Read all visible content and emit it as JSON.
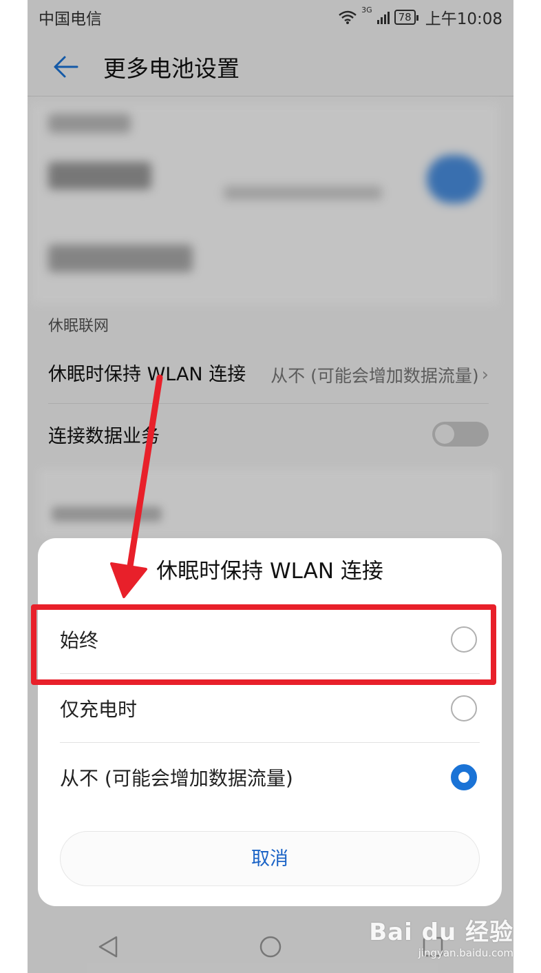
{
  "status_bar": {
    "carrier": "中国电信",
    "network": "3G",
    "battery": "78",
    "time": "上午10:08"
  },
  "header": {
    "title": "更多电池设置",
    "back_icon": "back-arrow-icon"
  },
  "settings": {
    "section_label": "休眠联网",
    "wlan_row": {
      "label": "休眠时保持 WLAN 连接",
      "value": "从不 (可能会增加数据流量)"
    },
    "data_row": {
      "label": "连接数据业务",
      "toggle_on": false
    }
  },
  "dialog": {
    "title": "休眠时保持 WLAN 连接",
    "options": [
      {
        "label": "始终",
        "selected": false
      },
      {
        "label": "仅充电时",
        "selected": false
      },
      {
        "label": "从不 (可能会增加数据流量)",
        "selected": true
      }
    ],
    "cancel_label": "取消"
  },
  "colors": {
    "accent": "#1a73d6",
    "annotation_red": "#e8202a"
  },
  "watermark": {
    "logo": "Bai du 经验",
    "url": "jingyan.baidu.com"
  }
}
